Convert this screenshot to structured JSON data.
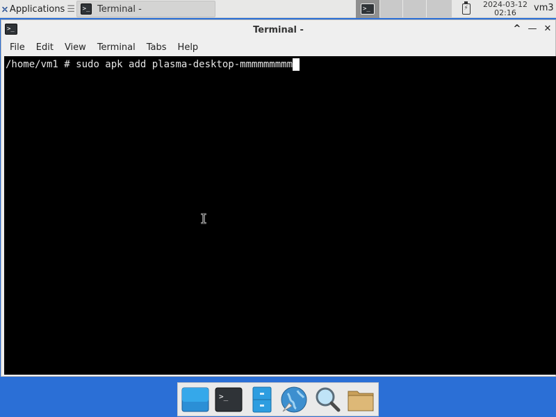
{
  "top_panel": {
    "applications_label": "Applications",
    "taskbar_item_label": "Terminal -",
    "clock_date": "2024-03-12",
    "clock_time": "02:16",
    "user_label": "vm3"
  },
  "window": {
    "title": "Terminal -",
    "controls": {
      "maximize": "^",
      "minimize": "—",
      "close": "✕"
    },
    "menu": [
      "File",
      "Edit",
      "View",
      "Terminal",
      "Tabs",
      "Help"
    ]
  },
  "terminal": {
    "prompt": "/home/vm1 # ",
    "command": "sudo apk add plasma-desktop-mmmmmmmmm"
  },
  "dock": {
    "items": [
      "show-desktop-icon",
      "terminal-icon",
      "file-manager-icon",
      "web-browser-icon",
      "app-finder-icon",
      "folder-icon"
    ]
  },
  "colors": {
    "desktop": "#2b6fd6",
    "panel": "#e8e8e7",
    "terminal_bg": "#000000",
    "terminal_fg": "#e6e6e6"
  }
}
